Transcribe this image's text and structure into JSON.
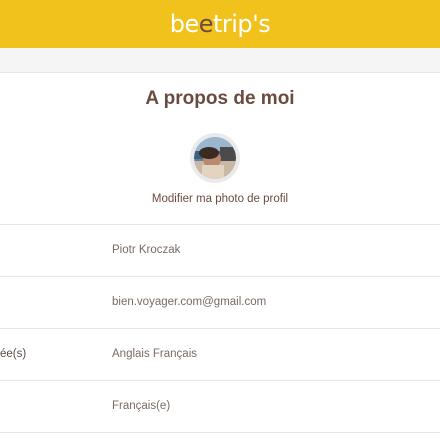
{
  "header": {
    "logo_part1": "be",
    "logo_part2": "e",
    "logo_part3": "trip's",
    "color": "#f1c21b"
  },
  "page": {
    "title": "A propos de moi",
    "photo_link": "Modifier ma photo de profil"
  },
  "fields": [
    {
      "label": "",
      "value": "Piotr Kroczak"
    },
    {
      "label": "",
      "value": "bien.voyager.com@gmail.com"
    },
    {
      "label": "ée(s)",
      "value": "Anglais Français"
    },
    {
      "label": "",
      "value": "Français(e)"
    }
  ],
  "colors": {
    "accent_brown": "#6b4a3f",
    "header_yellow": "#f1c21b"
  }
}
